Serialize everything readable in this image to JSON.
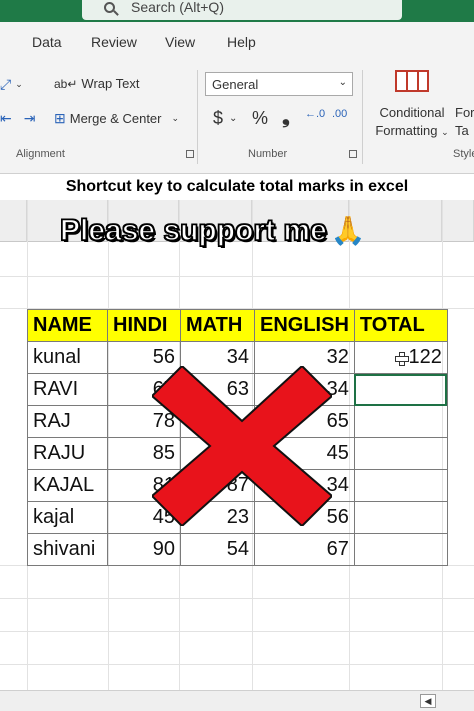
{
  "search": {
    "placeholder": "Search (Alt+Q)"
  },
  "menu": {
    "tabs": [
      "Data",
      "Review",
      "View",
      "Help"
    ]
  },
  "ribbon": {
    "wrap_text": "Wrap Text",
    "merge_center": "Merge & Center",
    "number_format": "General",
    "currency_symbol": "$",
    "percent_symbol": "%",
    "comma_symbol": "̹",
    "conditional_formatting_line1": "Conditional",
    "conditional_formatting_line2": "Formatting",
    "format_partial_line1": "For",
    "format_partial_line2": "Ta",
    "groups": {
      "alignment": "Alignment",
      "number": "Number",
      "styles": "Style"
    }
  },
  "overlay": {
    "caption": "Shortcut key to calculate  total marks in excel",
    "support": "Please support me"
  },
  "table": {
    "headers": [
      "NAME",
      "HINDI",
      "MATH",
      "ENGLISH",
      "TOTAL"
    ],
    "rows": [
      [
        "kunal",
        "56",
        "34",
        "32",
        "122"
      ],
      [
        "RAVI",
        "67",
        "63",
        "34",
        ""
      ],
      [
        "RAJ",
        "78",
        "",
        "65",
        ""
      ],
      [
        "RAJU",
        "85",
        "",
        "45",
        ""
      ],
      [
        "KAJAL",
        "81",
        "87",
        "34",
        ""
      ],
      [
        "kajal",
        "45",
        "23",
        "56",
        ""
      ],
      [
        "shivani",
        "90",
        "54",
        "67",
        ""
      ]
    ]
  },
  "colors": {
    "excel_green": "#1f7a47",
    "header_yellow": "#ffff00",
    "x_red": "#e8131b"
  }
}
